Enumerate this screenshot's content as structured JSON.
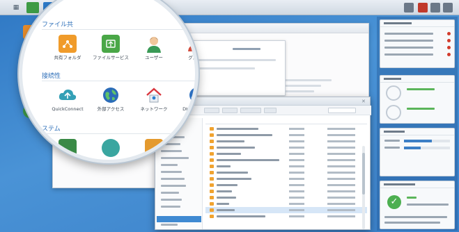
{
  "lens": {
    "sections": {
      "file_section": "ファイル共",
      "connect_section": "接続性",
      "system_section": "ステム"
    },
    "row1": [
      {
        "label": "共有フォルダ",
        "icon": "shared-folder-icon"
      },
      {
        "label": "ファイルサービス",
        "icon": "file-services-icon"
      },
      {
        "label": "ユーザー",
        "icon": "user-icon"
      },
      {
        "label": "グループ",
        "icon": "group-icon"
      }
    ],
    "row2": [
      {
        "label": "QuickConnect",
        "icon": "quickconnect-cloud-icon"
      },
      {
        "label": "外部アクセス",
        "icon": "external-access-globe-icon"
      },
      {
        "label": "ネットワーク",
        "icon": "network-house-icon"
      },
      {
        "label": "DHCP Server",
        "icon": "dhcp-server-icon"
      }
    ]
  },
  "colors": {
    "desktop": "#3a82cc",
    "accent_blue": "#2e6fb9",
    "folder_orange": "#f0a330",
    "status_green": "#4caf50",
    "alert_red": "#d23b2c"
  }
}
